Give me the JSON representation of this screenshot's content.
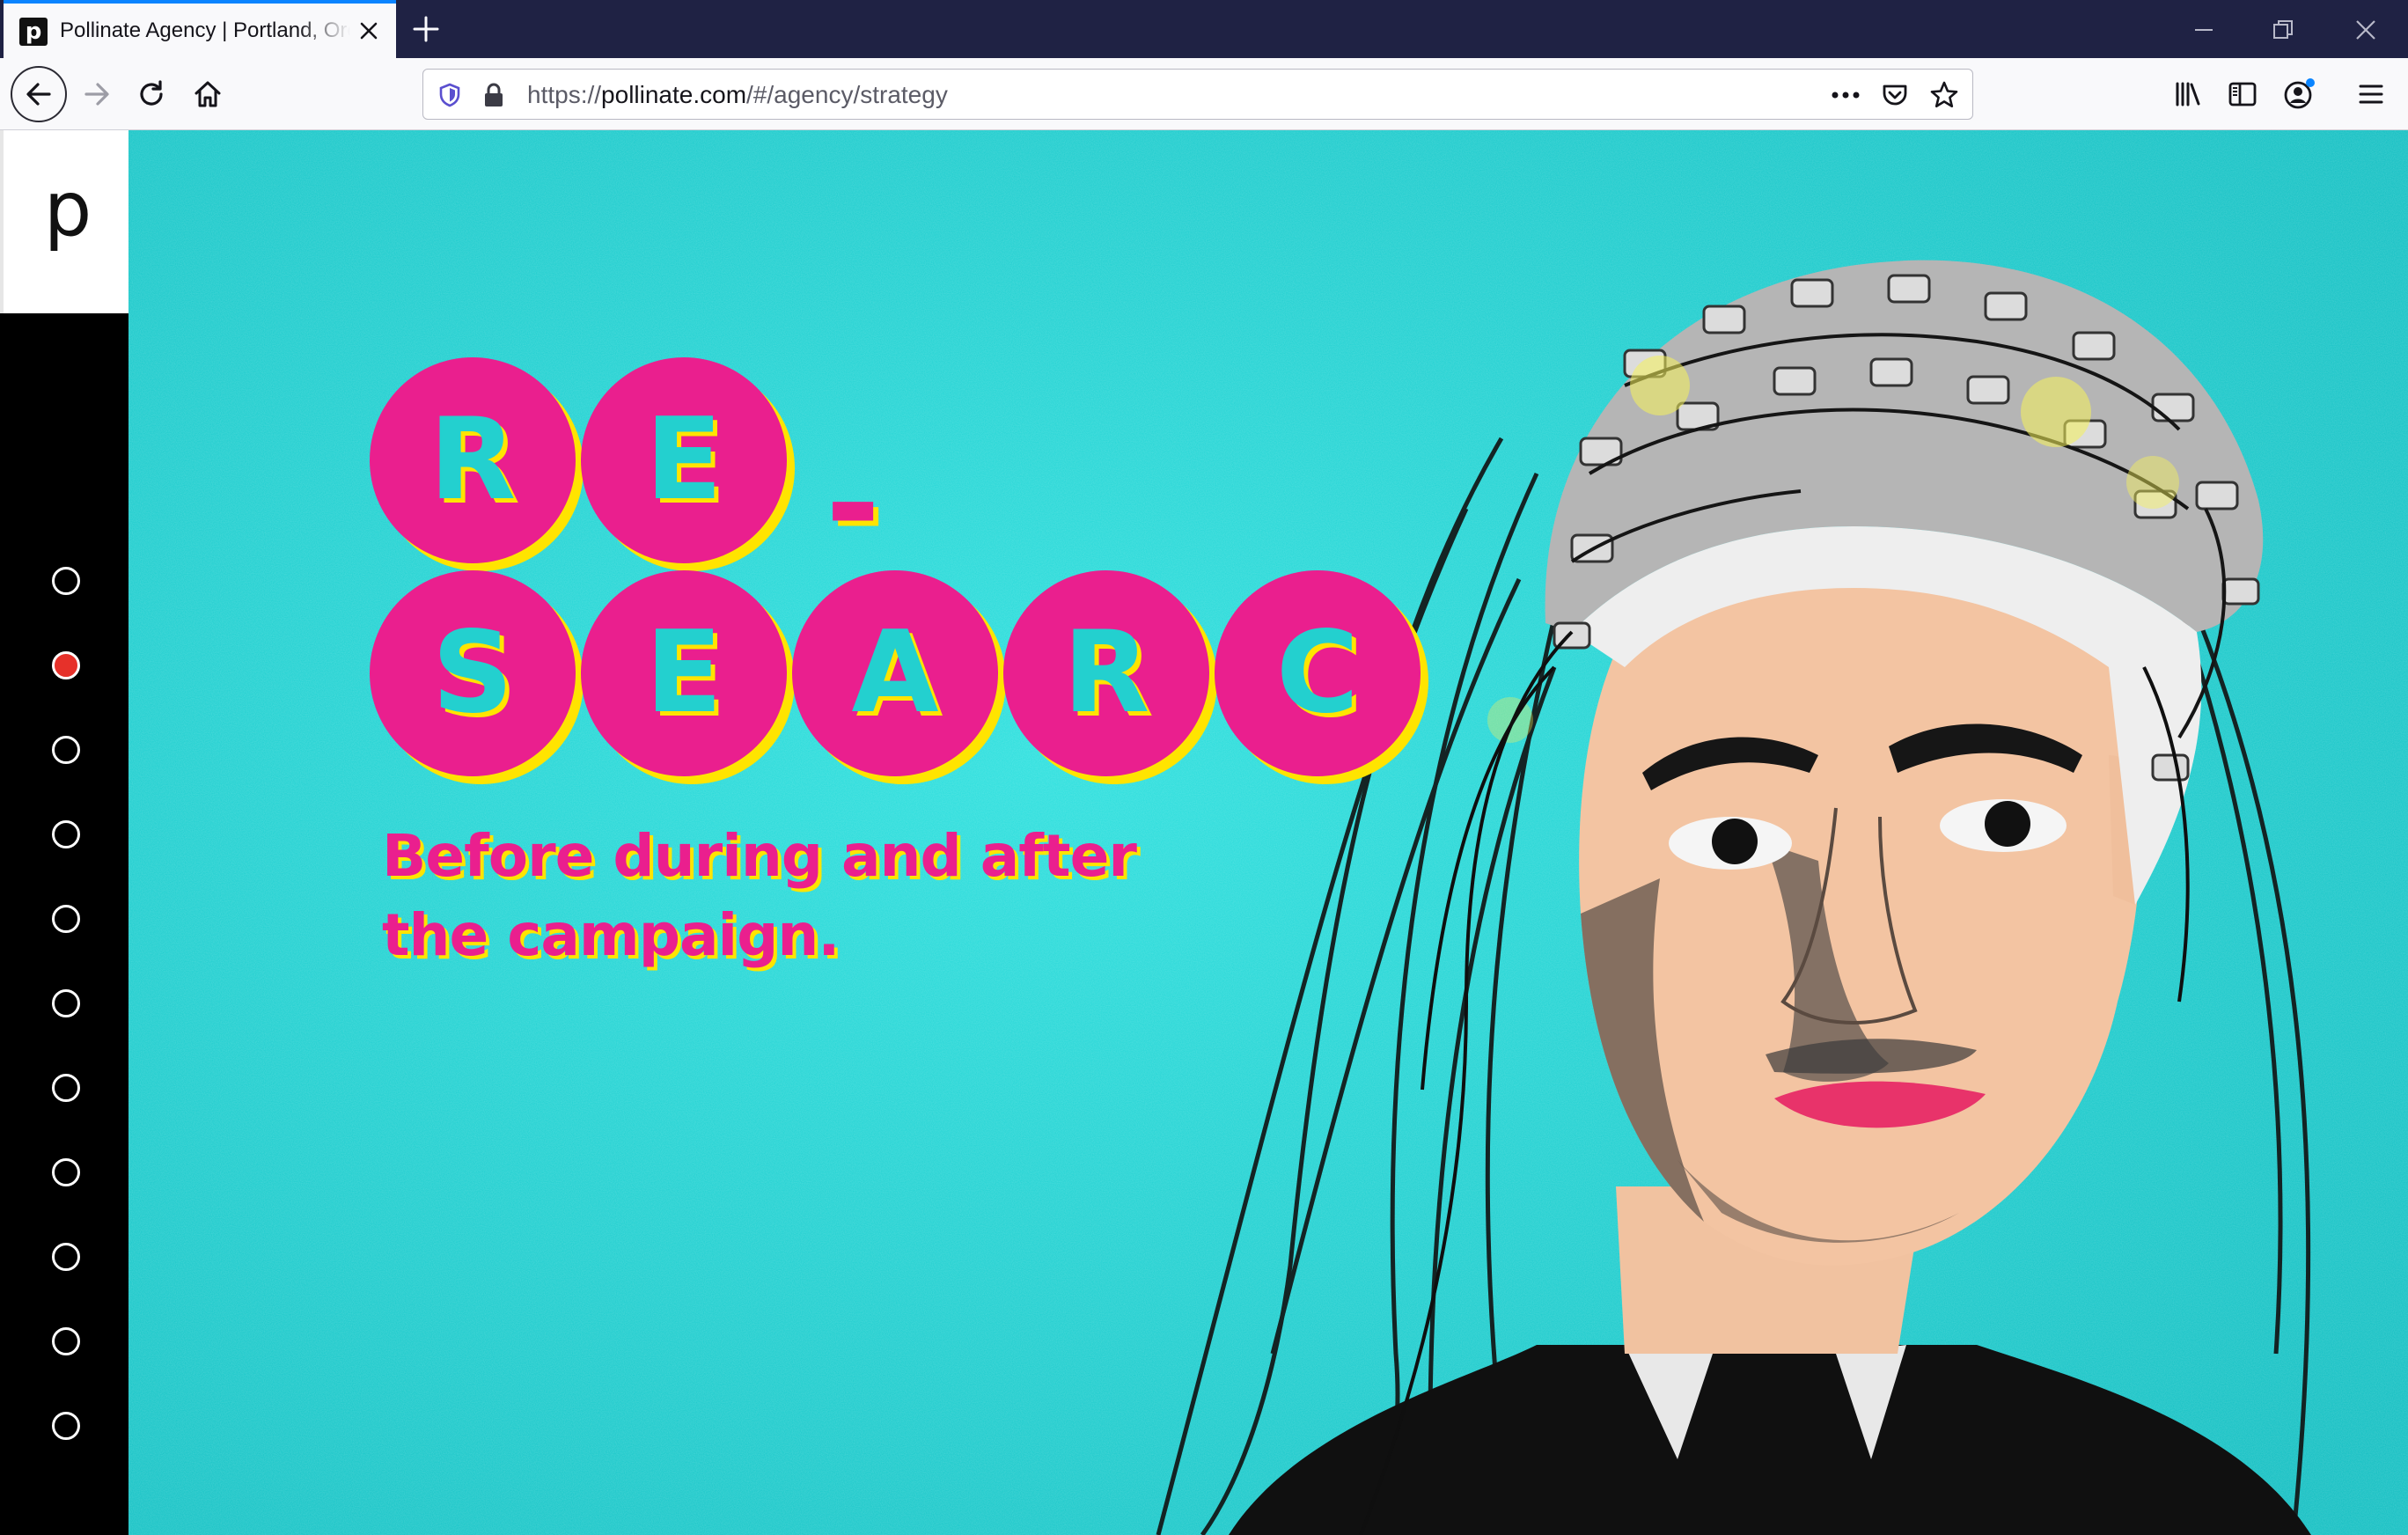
{
  "browser": {
    "tab_title": "Pollinate Agency | Portland, Oregon",
    "favicon_letter": "p",
    "url_prefix": "https://",
    "url_domain": "pollinate.com",
    "url_path": "/#/agency/strategy"
  },
  "sidebar": {
    "logo": "p",
    "nav_dots": [
      "1",
      "2",
      "3",
      "4",
      "5",
      "6",
      "7",
      "8",
      "9",
      "10",
      "11"
    ],
    "active_index": 1
  },
  "hero": {
    "headline_line1": [
      "R",
      "E"
    ],
    "headline_dash": "-",
    "headline_line2": [
      "S",
      "E",
      "A",
      "R",
      "C"
    ],
    "tagline_line1": "Before during and after",
    "tagline_line2": "the campaign."
  },
  "colors": {
    "background": "#1ad0d0",
    "accent_pink": "#ea1f8e",
    "accent_yellow": "#ffe400",
    "active_dot": "#e6312a"
  }
}
